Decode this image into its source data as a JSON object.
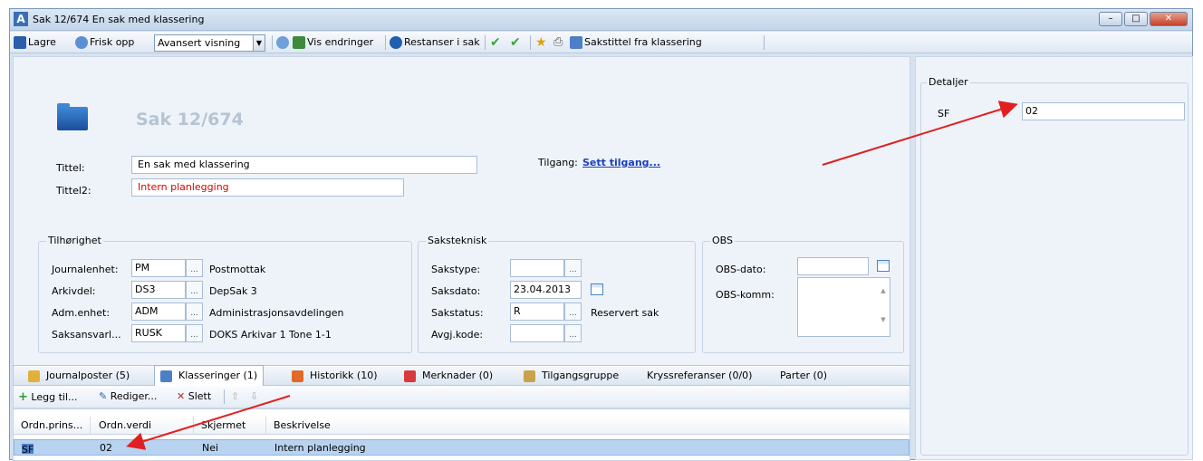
{
  "window": {
    "icon": "A",
    "title": "Sak 12/674 En sak med klassering"
  },
  "toolbar": {
    "save": "Lagre",
    "refresh": "Frisk opp",
    "view": "Avansert visning",
    "show_changes": "Vis endringer",
    "pending": "Restanser i sak",
    "title_from_class": "Sakstittel fra klassering"
  },
  "header": {
    "case_id": "Sak 12/674"
  },
  "fields": {
    "title_label": "Tittel:",
    "title_value": "En sak med klassering",
    "title2_label": "Tittel2:",
    "title2_value": "Intern planlegging",
    "access_label": "Tilgang:",
    "access_link": "Sett tilgang..."
  },
  "tilhorighet": {
    "title": "Tilhørighet",
    "rows": [
      {
        "label": "Journalenhet:",
        "code": "PM",
        "desc": "Postmottak"
      },
      {
        "label": "Arkivdel:",
        "code": "DS3",
        "desc": "DepSak 3"
      },
      {
        "label": "Adm.enhet:",
        "code": "ADM",
        "desc": "Administrasjonsavdelingen"
      },
      {
        "label": "Saksansvarl...",
        "code": "RUSK",
        "desc": "DOKS Arkivar 1 Tone 1-1"
      }
    ]
  },
  "saksteknisk": {
    "title": "Saksteknisk",
    "rows": [
      {
        "label": "Sakstype:",
        "value": "",
        "desc": ""
      },
      {
        "label": "Saksdato:",
        "value": "23.04.2013",
        "desc": ""
      },
      {
        "label": "Sakstatus:",
        "value": "R",
        "desc": "Reservert sak"
      },
      {
        "label": "Avgj.kode:",
        "value": "",
        "desc": ""
      }
    ]
  },
  "obs": {
    "title": "OBS",
    "date_label": "OBS-dato:",
    "comment_label": "OBS-komm:"
  },
  "tabs": [
    "Journalposter (5)",
    "Klasseringer (1)",
    "Historikk (10)",
    "Merknader (0)",
    "Tilgangsgruppe",
    "Kryssreferanser (0/0)",
    "Parter (0)"
  ],
  "subtoolbar": {
    "add": "Legg til...",
    "edit": "Rediger...",
    "delete": "Slett"
  },
  "grid": {
    "headers": [
      "Ordn.prins...",
      "Ordn.verdi",
      "Skjermet",
      "Beskrivelse"
    ],
    "row": [
      "SF",
      "02",
      "Nei",
      "Intern planlegging"
    ]
  },
  "details": {
    "title": "Detaljer",
    "label": "SF",
    "value": "02"
  },
  "colors": {
    "accent": "#1a3fc0",
    "arrow": "#e02020",
    "red_text": "#e00000"
  }
}
